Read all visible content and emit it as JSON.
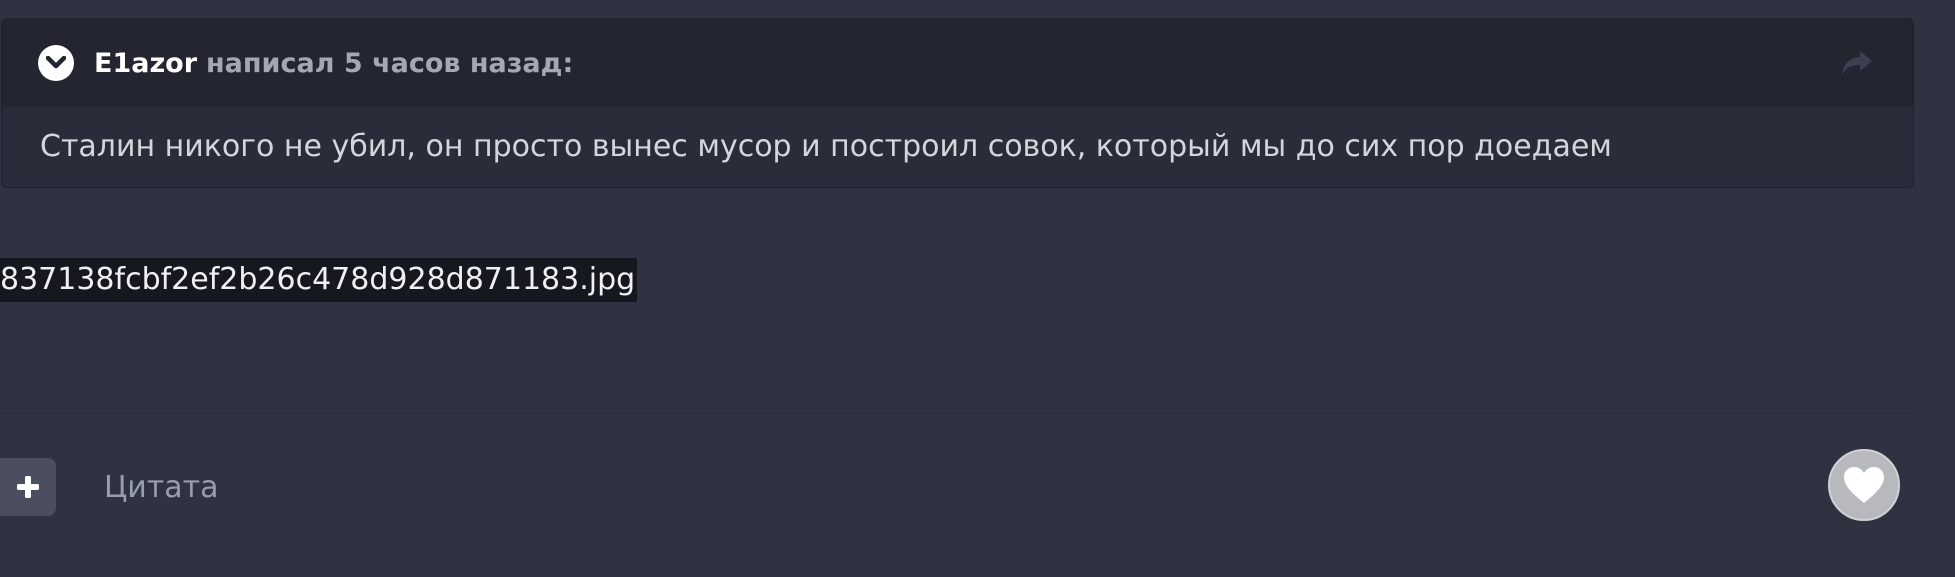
{
  "quote": {
    "author": "E1azor",
    "meta": "написал 5 часов назад:",
    "text": "Сталин никого не убил, он просто вынес мусор и построил совок, который мы до сих пор доедаем"
  },
  "attachment": {
    "filename": "837138fcbf2ef2b26c478d928d871183.jpg"
  },
  "footer": {
    "quote_label": "Цитата"
  },
  "icons": {
    "collapse": "chevron-down-icon",
    "share": "share-arrow-icon",
    "add": "plus-icon",
    "like": "heart-icon"
  },
  "colors": {
    "background": "#2f3341",
    "quote_header": "#232630",
    "quote_body": "#292d39",
    "like_button": "#b7b9be"
  }
}
